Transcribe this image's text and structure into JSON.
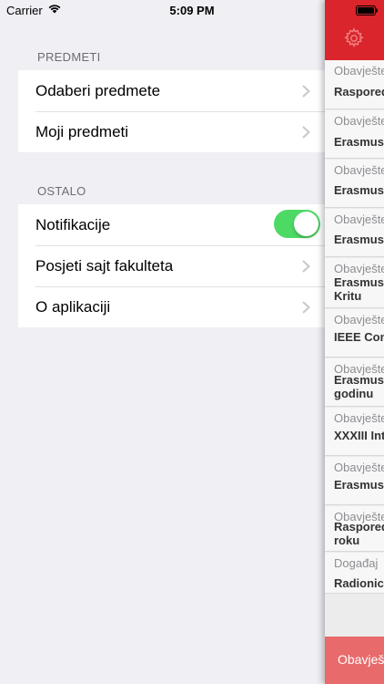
{
  "status_bar": {
    "carrier": "Carrier",
    "time": "5:09 PM"
  },
  "settings": {
    "sections": [
      {
        "header": "PREDMETI",
        "rows": [
          {
            "label": "Odaberi predmete"
          },
          {
            "label": "Moji predmeti"
          }
        ]
      },
      {
        "header": "OSTALO",
        "rows": [
          {
            "label": "Notifikacije",
            "toggle_on": true
          },
          {
            "label": "Posjeti sajt fakulteta"
          },
          {
            "label": "O aplikaciji"
          }
        ]
      }
    ]
  },
  "feed": {
    "items": [
      {
        "category": "Obavješte",
        "title": "Raspored"
      },
      {
        "category": "Obavješte",
        "title": "Erasmus"
      },
      {
        "category": "Obavješte",
        "title": "Erasmus"
      },
      {
        "category": "Obavješte",
        "title": "Erasmus"
      },
      {
        "category": "Obavješte",
        "title": "Erasmus Kritu"
      },
      {
        "category": "Obavješte",
        "title": "IEEE Com"
      },
      {
        "category": "Obavješte",
        "title": "Erasmus godinu"
      },
      {
        "category": "Obavješte",
        "title": "XXXIII Int"
      },
      {
        "category": "Obavješte",
        "title": "Erasmus"
      },
      {
        "category": "Obavješte",
        "title": "Raspored roku"
      },
      {
        "category": "Događaj",
        "title": "Radionica"
      }
    ],
    "footer_label": "Obavješ"
  },
  "colors": {
    "accent_red": "#d9252b",
    "toggle_green": "#4cd964",
    "footer_red": "#e86a6a"
  },
  "icons": {
    "wifi": "wifi-icon",
    "battery": "battery-icon",
    "gear": "gear-icon",
    "chevron": "chevron-right-icon"
  }
}
